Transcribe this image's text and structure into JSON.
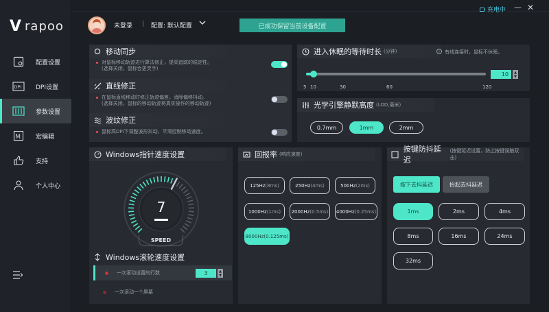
{
  "brand": {
    "logo_mark": "V",
    "logo_text": "rapoo",
    "accent": "#4ee6c9"
  },
  "sidebar": {
    "items": [
      {
        "label": "配置设置",
        "icon": "config-icon"
      },
      {
        "label": "DPI设置",
        "icon": "dpi-icon"
      },
      {
        "label": "参数设置",
        "icon": "params-icon",
        "active": true
      },
      {
        "label": "宏编辑",
        "icon": "macro-icon"
      },
      {
        "label": "支持",
        "icon": "thumbs-up-icon"
      },
      {
        "label": "个人中心",
        "icon": "user-icon"
      }
    ]
  },
  "header": {
    "login": "未登录",
    "separator": "|",
    "config": "配置: 默认配置",
    "save_button": "已成功保留当前设备配置",
    "charging": "充电中"
  },
  "motion_sync": {
    "title": "移动同步",
    "desc": [
      "对鼠标移动轨迹进行算法修正，提高追踪的稳定性。",
      "(选择关闭，鼠标会更灵手)"
    ],
    "enabled": true
  },
  "angle_snap": {
    "title": "直线修正",
    "desc": [
      "在鼠标直线移动时修正轨迹偏差，消除偏移抖动。",
      "(选择关闭，鼠标的移动轨迹将真实操作的移动轨迹)"
    ],
    "enabled": false
  },
  "ripple": {
    "title": "波纹修正",
    "desc": [
      "鼠标高DPI下调整波形抖动，平滑控制移动速度。"
    ],
    "enabled": false
  },
  "sleep": {
    "title": "进入休眠的等待时长",
    "unit": "(分钟)",
    "hint": "有线连接时，鼠标不休眠。",
    "value": "10",
    "min": 5,
    "max": 120,
    "ticks": [
      "5",
      "10",
      "30",
      "60",
      "120"
    ]
  },
  "lod": {
    "title": "光学引擎静默高度",
    "unit": "(LOD,毫米)",
    "options": [
      "0.7mm",
      "1mm",
      "2mm"
    ],
    "selected": 1
  },
  "pointer_speed": {
    "title": "Windows指针速度设置",
    "value": "7",
    "gauge_label": "SPEED",
    "level_fraction": 0.6
  },
  "scroll_speed": {
    "title": "Windows滚轮速度设置",
    "rows": [
      {
        "label": "一次滚动设置的行数",
        "value": "3",
        "selected": true
      },
      {
        "label": "一次滚动一个屏幕",
        "selected": false
      }
    ]
  },
  "polling": {
    "title": "回报率",
    "unit": "(响应速度)",
    "options": [
      {
        "rate": "125Hz",
        "ms": "(8ms)"
      },
      {
        "rate": "250Hz",
        "ms": "(4ms)"
      },
      {
        "rate": "500Hz",
        "ms": "(2ms)"
      },
      {
        "rate": "1000Hz",
        "ms": "(1ms)"
      },
      {
        "rate": "2000Hz",
        "ms": "(0.5ms)"
      },
      {
        "rate": "4000Hz",
        "ms": "(0.25ms)"
      },
      {
        "rate": "8000Hz",
        "ms": "(0.125ms)"
      }
    ],
    "selected": 6
  },
  "debounce": {
    "title": "按键防抖延迟",
    "unit": "(按键延迟设置，防止按键误触双击)",
    "tabs": [
      "按下去抖延迟",
      "抬起去抖延迟"
    ],
    "active_tab": 0,
    "options": [
      "1ms",
      "2ms",
      "4ms",
      "8ms",
      "16ms",
      "24ms",
      "32ms"
    ],
    "selected": 0
  }
}
